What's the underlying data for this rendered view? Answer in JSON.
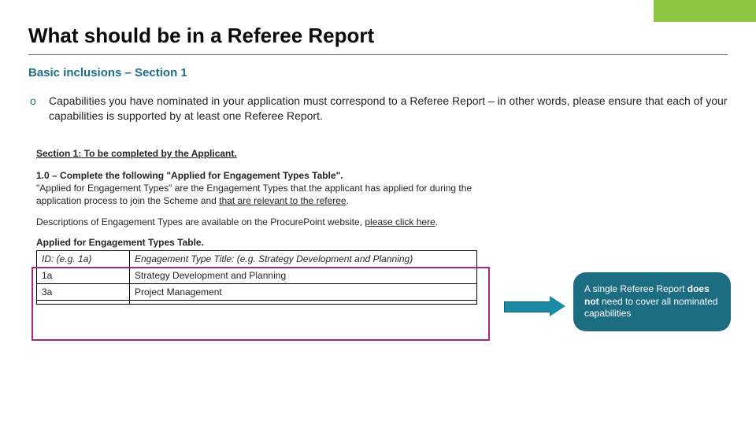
{
  "accentColor": "#8cc63f",
  "title": "What should be in a Referee Report",
  "subtitle": "Basic inclusions – Section 1",
  "bullet": {
    "marker": "o",
    "text": "Capabilities you have nominated in your application must correspond to a Referee Report – in other words, please ensure that each of your capabilities is supported by at least one Referee Report."
  },
  "section": {
    "heading": "Section 1: To be completed by the Applicant.",
    "line1_strong": "1.0 – Complete the following \"Applied for Engagement Types Table\".",
    "line2a": "\"Applied for Engagement Types\" are the Engagement Types that the applicant has applied for during the application process to join the Scheme and ",
    "line2b_underline": "that are relevant to the referee",
    "line2c": ".",
    "line3a": "Descriptions of Engagement Types are available on the ProcurePoint website, ",
    "line3b_underline": "please click here",
    "line3c": ".",
    "table_caption": "Applied for Engagement Types Table."
  },
  "table": {
    "header_id": "ID: (e.g. 1a)",
    "header_title": "Engagement Type Title: (e.g. Strategy Development and Planning)",
    "rows": [
      {
        "id": "1a",
        "title": "Strategy Development and Planning"
      },
      {
        "id": "3a",
        "title": "Project Management"
      },
      {
        "id": "",
        "title": ""
      }
    ]
  },
  "callout": {
    "pre": "A single Referee Report ",
    "strong": "does not",
    "post": " need to cover all nominated capabilities"
  }
}
